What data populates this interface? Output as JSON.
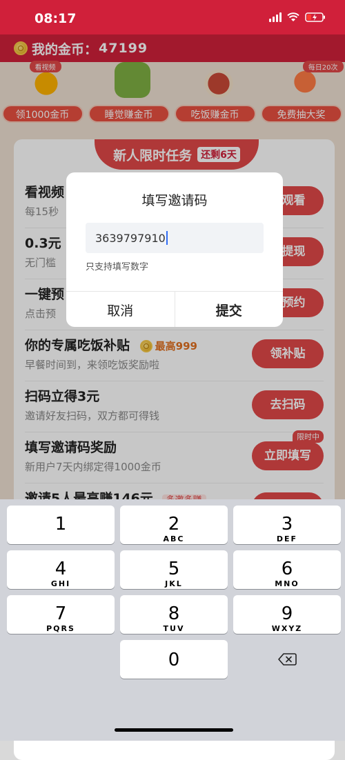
{
  "status_bar": {
    "time": "08:17"
  },
  "header": {
    "label": "我的金币：",
    "value": "47199"
  },
  "features": [
    {
      "badge": "看视频",
      "label": "领1000金币",
      "art": "coins"
    },
    {
      "badge": "",
      "label": "睡觉赚金币",
      "art": "sleep"
    },
    {
      "badge": "",
      "label": "吃饭赚金币",
      "art": "food"
    },
    {
      "badge": "每日20次",
      "label": "免费抽大奖",
      "art": "draw"
    }
  ],
  "tasks_banner": {
    "title": "新人限时任务",
    "tag": "还剩6天"
  },
  "tasks": [
    {
      "title": "看视频",
      "sub": "每15秒",
      "action": "即观看"
    },
    {
      "title": "0.3元",
      "sub": "无门槛",
      "action": "即提现"
    },
    {
      "title": "一键预",
      "sub": "点击预",
      "action": "即预约"
    },
    {
      "title": "你的专属吃饭补贴",
      "bonus": "最高999",
      "sub": "早餐时间到，来领吃饭奖励啦",
      "action": "领补贴"
    },
    {
      "title": "扫码立得3元",
      "sub": "邀请好友扫码，双方都可得钱",
      "action": "去扫码"
    },
    {
      "title": "填写邀请码奖励",
      "sub": "新用户7天内绑定得1000金币",
      "action": "立即填写",
      "flag": "限时中"
    },
    {
      "title": "邀请5人最高赚146元",
      "pill": "多邀多赚",
      "sub": "",
      "action": ""
    }
  ],
  "modal": {
    "title": "填写邀请码",
    "input_value": "3639797910",
    "hint": "只支持填写数字",
    "cancel": "取消",
    "submit": "提交"
  },
  "keypad": {
    "keys": [
      {
        "digit": "1",
        "letters": ""
      },
      {
        "digit": "2",
        "letters": "ABC"
      },
      {
        "digit": "3",
        "letters": "DEF"
      },
      {
        "digit": "4",
        "letters": "GHI"
      },
      {
        "digit": "5",
        "letters": "JKL"
      },
      {
        "digit": "6",
        "letters": "MNO"
      },
      {
        "digit": "7",
        "letters": "PQRS"
      },
      {
        "digit": "8",
        "letters": "TUV"
      },
      {
        "digit": "9",
        "letters": "WXYZ"
      },
      {
        "digit": "0",
        "letters": ""
      }
    ]
  },
  "colors": {
    "brand": "#d0203a",
    "accent": "#e04848",
    "caret": "#2f6cf5"
  },
  "icons": {
    "delete_key": "backspace-icon",
    "header_coin": "coin-icon"
  }
}
